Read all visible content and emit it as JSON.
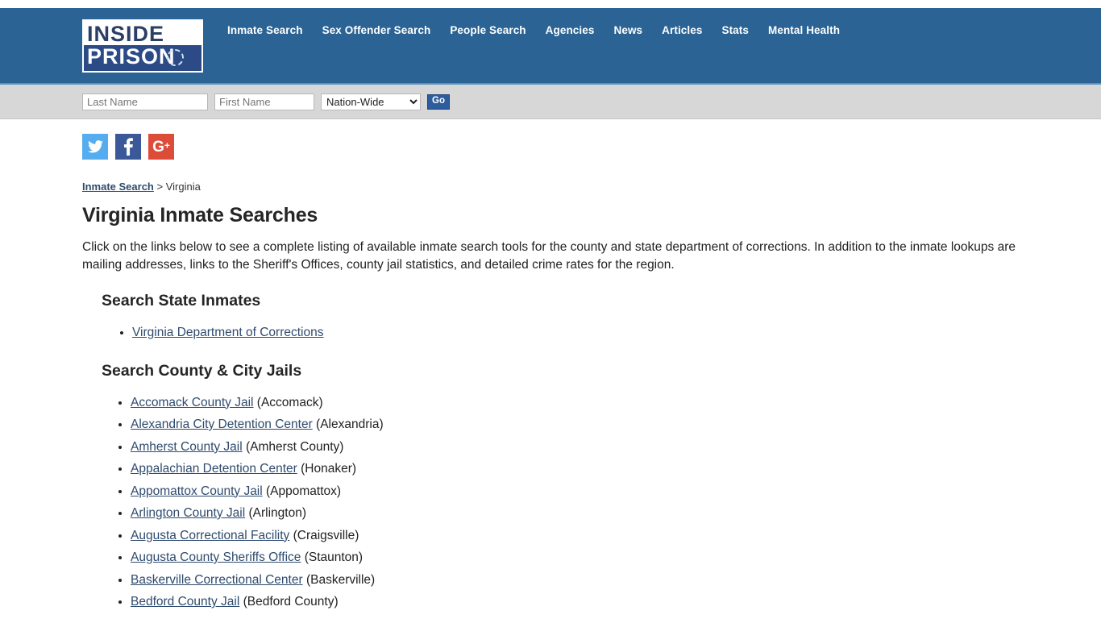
{
  "header": {
    "logo": {
      "line1": "INSIDE",
      "line2": "PRISON"
    },
    "nav": [
      {
        "label": "Inmate Search"
      },
      {
        "label": "Sex Offender Search"
      },
      {
        "label": "People Search"
      },
      {
        "label": "Agencies"
      },
      {
        "label": "News"
      },
      {
        "label": "Articles"
      },
      {
        "label": "Stats"
      },
      {
        "label": "Mental Health"
      }
    ],
    "colors": {
      "header_blue": "#2a6394",
      "search_band_gray": "#d7d7d7",
      "go_button_blue": "#2e5d9e",
      "link_blue": "#2f4b6e"
    }
  },
  "search": {
    "last_name_placeholder": "Last Name",
    "last_name_value": "",
    "first_name_placeholder": "First Name",
    "first_name_value": "",
    "scope_selected": "Nation-Wide",
    "scope_options": [
      "Nation-Wide"
    ],
    "go_label": "Go"
  },
  "social": [
    {
      "name": "twitter",
      "label": "Twitter",
      "color": "#55acee"
    },
    {
      "name": "facebook",
      "label": "Facebook",
      "color": "#3b5998"
    },
    {
      "name": "google-plus",
      "label": "Google Plus",
      "color": "#dd4b39"
    }
  ],
  "breadcrumb": {
    "link": "Inmate Search",
    "separator": ">",
    "current": "Virginia"
  },
  "page": {
    "title": "Virginia Inmate Searches",
    "intro": "Click on the links below to see a complete listing of available inmate search tools for the county and state department of corrections. In addition to the inmate lookups are mailing addresses, links to the Sheriff's Offices, county jail statistics, and detailed crime rates for the region."
  },
  "sections": [
    {
      "heading": "Search State Inmates",
      "items": [
        {
          "link": "Virginia Department of Corrections",
          "place": ""
        }
      ]
    },
    {
      "heading": "Search County & City Jails",
      "items": [
        {
          "link": "Accomack County Jail",
          "place": "(Accomack)"
        },
        {
          "link": "Alexandria City Detention Center",
          "place": "(Alexandria)"
        },
        {
          "link": "Amherst County Jail",
          "place": "(Amherst County)"
        },
        {
          "link": "Appalachian Detention Center",
          "place": "(Honaker)"
        },
        {
          "link": "Appomattox County Jail",
          "place": "(Appomattox)"
        },
        {
          "link": "Arlington County Jail",
          "place": "(Arlington)"
        },
        {
          "link": "Augusta Correctional Facility",
          "place": "(Craigsville)"
        },
        {
          "link": "Augusta County Sheriffs Office",
          "place": "(Staunton)"
        },
        {
          "link": "Baskerville Correctional Center",
          "place": "(Baskerville)"
        },
        {
          "link": "Bedford County Jail",
          "place": "(Bedford County)"
        }
      ]
    }
  ]
}
